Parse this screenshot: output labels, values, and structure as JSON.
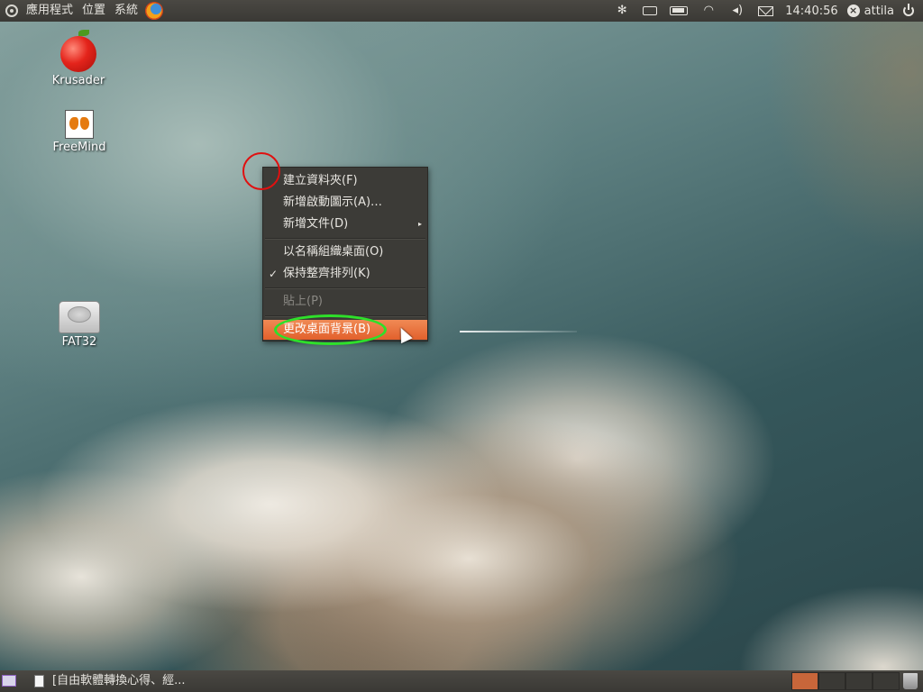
{
  "top_panel": {
    "menus": [
      "應用程式",
      "位置",
      "系統"
    ],
    "clock": "14:40:56",
    "user": "attila"
  },
  "desktop_icons": [
    {
      "label": "Krusader",
      "icon": "krusader-apple-icon"
    },
    {
      "label": "FreeMind",
      "icon": "freemind-butterfly-icon"
    },
    {
      "label": "FAT32",
      "icon": "hard-drive-icon"
    }
  ],
  "context_menu": {
    "items": [
      {
        "label": "建立資料夾(F)"
      },
      {
        "label": "新增啟動圖示(A)…"
      },
      {
        "label": "新增文件(D)",
        "submenu": true
      },
      {
        "label": "以名稱組織桌面(O)"
      },
      {
        "label": "保持整齊排列(K)",
        "checked": true
      },
      {
        "label": "貼上(P)",
        "disabled": true
      },
      {
        "label": "更改桌面背景(B)",
        "highlighted": true
      }
    ],
    "check_glyph": "✓",
    "submenu_glyph": "▸"
  },
  "bottom_panel": {
    "task_label": "[自由軟體轉換心得、經...",
    "workspaces": 4,
    "active_workspace": 1
  },
  "colors": {
    "panel": "#3c3b37",
    "highlight": "#e2602c",
    "annotation_red": "#e01010",
    "annotation_green": "#2ee02a"
  }
}
